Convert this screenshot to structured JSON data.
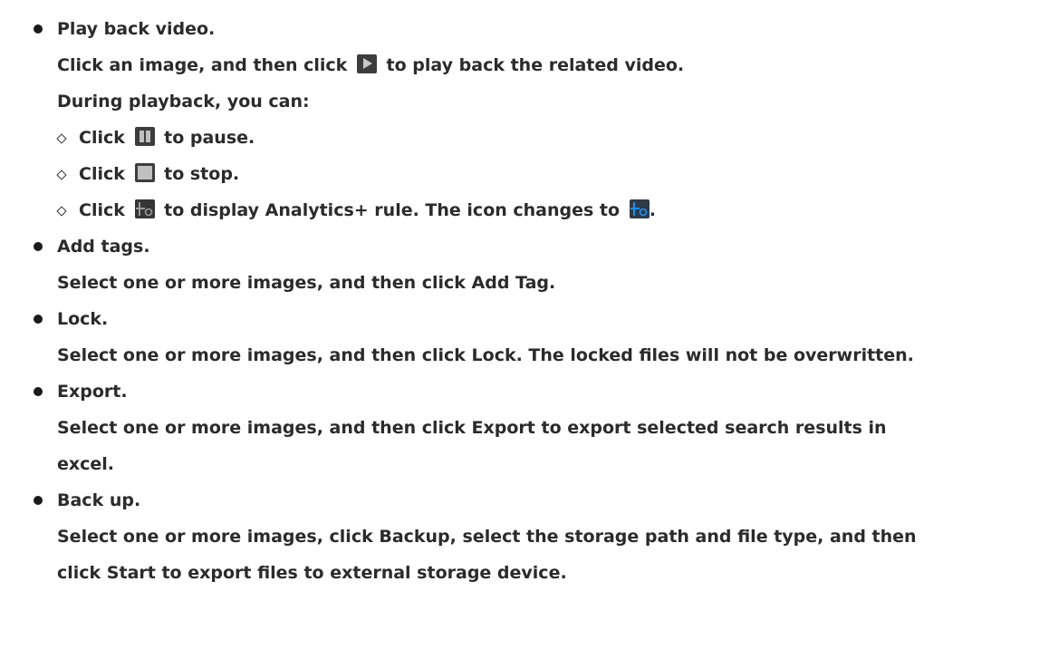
{
  "items": [
    {
      "heading": "Play back video.",
      "lines": [
        "Click an image, and then click",
        "to play back the related video.",
        "During playback, you can:"
      ],
      "sub": [
        {
          "prefix": "Click",
          "suffix": "to pause.",
          "icon": "pause-icon"
        },
        {
          "prefix": "Click",
          "suffix": "to stop.",
          "icon": "stop-icon"
        },
        {
          "prefix": "Click",
          "middle": "to display Analytics+ rule. The icon changes to",
          "suffix": ".",
          "icon": "analytics-rule-icon",
          "icon2": "analytics-rule-active-icon"
        }
      ],
      "icon": "play-icon"
    },
    {
      "heading": "Add tags.",
      "lines": [
        "Select one or more images, and then click Add Tag."
      ]
    },
    {
      "heading": "Lock.",
      "lines": [
        "Select one or more images, and then click Lock. The locked files will not be overwritten."
      ]
    },
    {
      "heading": "Export.",
      "lines": [
        "Select one or more images, and then click Export to export selected search results in",
        "excel."
      ]
    },
    {
      "heading": "Back up.",
      "lines": [
        "Select one or more images, click Backup, select the storage path and file type, and then",
        "click Start to export files to external storage device."
      ]
    }
  ],
  "colors": {
    "text": "#2b2b2b",
    "icon_bg": "#3d3d3d",
    "rule_active": "#1e90ff"
  }
}
